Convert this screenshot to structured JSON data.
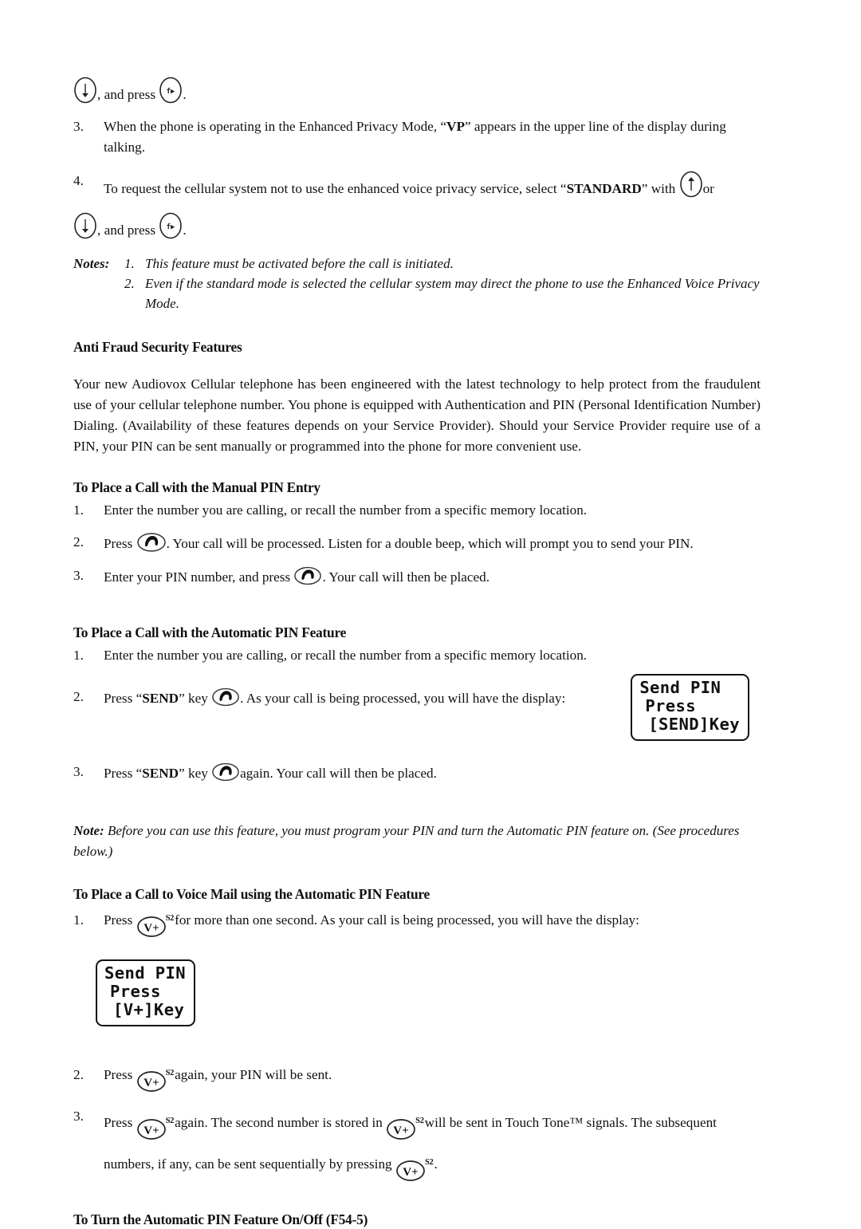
{
  "document": {
    "type": "cellular-phone-user-manual-page",
    "top_partial_line": {
      "before_key1": "",
      "mid": ", and press",
      "after": "."
    },
    "steps_top": [
      {
        "num": "3.",
        "text_before_bold": "When the phone is operating in the Enhanced Privacy Mode, “",
        "bold": "VP",
        "text_after_bold": "” appears in the upper line of the display during talking."
      },
      {
        "num": "4.",
        "text_before_bold": "To request the cellular system not to use the enhanced voice privacy service, select “",
        "bold": "STANDARD",
        "text_after_bold": "” with",
        "tail": "or"
      }
    ],
    "repeat_line": {
      "mid": ", and press",
      "after": "."
    },
    "notes_block": {
      "label": "Notes:",
      "items": [
        {
          "n": "1.",
          "text": "This feature must be activated before the call is initiated."
        },
        {
          "n": "2.",
          "text": "Even if the standard mode is selected the cellular system may direct the phone to use the Enhanced Voice Privacy Mode."
        }
      ]
    },
    "headings": {
      "anti_fraud": "Anti Fraud Security Features",
      "manual_pin": "To Place a Call with the Manual PIN Entry",
      "automatic_pin": "To Place a Call with the Automatic PIN Feature",
      "voice_mail_pin": "To Place a Call to Voice Mail using the Automatic PIN Feature",
      "turn_onoff": "To Turn the Automatic PIN Feature On/Off (F54-5)"
    },
    "anti_fraud_paragraph": "Your new Audiovox Cellular telephone has been engineered with the latest technology to help protect from the fraudulent use of your cellular telephone number.  You phone is equipped with Authentication and PIN (Personal Identification Number) Dialing.  (Availability of these features depends on your Service Provider).  Should your Service Provider require use of a PIN, your PIN can be sent manually or programmed into the phone for more convenient use.",
    "manual_pin_steps": [
      {
        "num": "1.",
        "text": "Enter the number you are calling, or recall the number from a specific memory location."
      },
      {
        "num": "2.",
        "pre": "Press",
        "post": ".  Your call will be processed.  Listen for a double beep, which will prompt you to send your PIN."
      },
      {
        "num": "3.",
        "pre": "Enter your PIN number, and press",
        "post": ".  Your call will then be placed."
      }
    ],
    "automatic_pin_steps": [
      {
        "num": "1.",
        "text": "Enter the number you are calling, or recall the number from a specific memory location."
      },
      {
        "num": "2.",
        "pre": "Press “",
        "bold": "SEND",
        "mid": "” key",
        "post": ".  As your call is being processed, you will have the display:"
      },
      {
        "num": "3.",
        "pre": "Press “",
        "bold": "SEND",
        "mid": "” key",
        "post": "again.  Your call will then be placed."
      }
    ],
    "automatic_pin_note": {
      "label": "Note:",
      "text": "Before you can use this feature, you must program your PIN and turn the Automatic PIN feature on.  (See procedures below.)"
    },
    "voice_mail_steps": [
      {
        "num": "1.",
        "pre": "Press",
        "post": "for more than one second.  As your call is being processed, you will have the display:"
      },
      {
        "num": "2.",
        "pre": "Press",
        "post": "again, your PIN will be sent."
      },
      {
        "num": "3.",
        "pre": "Press",
        "mid1": "again.  The second number is stored in",
        "mid2": "will be sent in Touch Tone™ signals.  The subsequent",
        "line2_pre": "numbers, if any, can be sent sequentially by pressing",
        "line2_post": "."
      }
    ],
    "lcd_displays": {
      "send_key": {
        "line1": "Send PIN",
        "line2": "Press",
        "line3": "[SEND]Key"
      },
      "vplus_key": {
        "line1": "Send PIN",
        "line2": "Press",
        "line3": "[V+]Key"
      }
    },
    "key_icons": {
      "down_arrow": "down-arrow-key-icon",
      "up_arrow": "up-arrow-key-icon",
      "function": "function-key-icon",
      "send": "send-handset-key-icon",
      "volume_up": "volume-up-key-icon",
      "volume_up_label": "V+",
      "volume_up_superscript": "S2"
    },
    "colors": {
      "ink": "#111111",
      "page": "#ffffff"
    }
  }
}
